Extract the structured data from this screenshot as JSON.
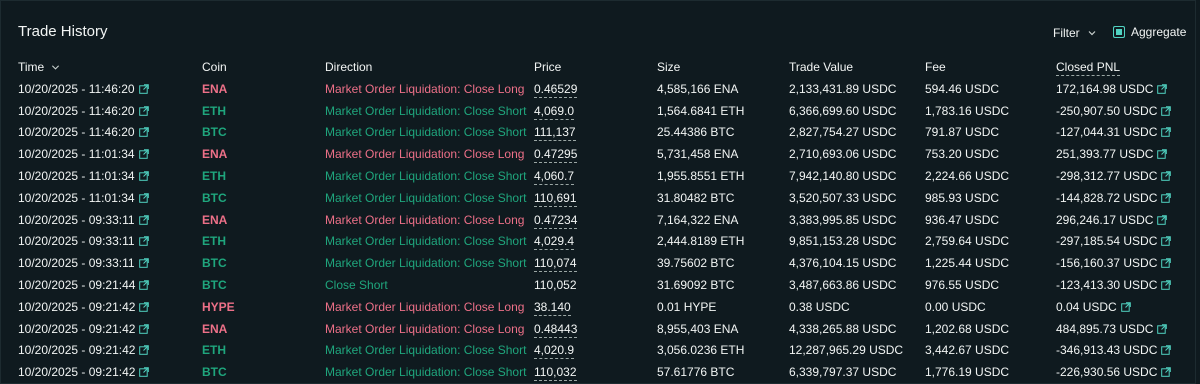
{
  "header": {
    "title": "Trade History",
    "filter_label": "Filter",
    "aggregate_label": "Aggregate",
    "aggregate_checked": true
  },
  "colors": {
    "long": "#ed7088",
    "short": "#1fa67d",
    "accent": "#50d2c1"
  },
  "columns": [
    "Time",
    "Coin",
    "Direction",
    "Price",
    "Size",
    "Trade Value",
    "Fee",
    "Closed PNL"
  ],
  "rows": [
    {
      "time": "10/20/2025 - 11:46:20",
      "coin": "ENA",
      "side": "long",
      "direction": "Market Order Liquidation: Close Long",
      "price": "0.46529",
      "price_dotted": true,
      "size": "4,585,166 ENA",
      "value": "2,133,431.89 USDC",
      "fee": "594.46 USDC",
      "pnl": "172,164.98 USDC"
    },
    {
      "time": "10/20/2025 - 11:46:20",
      "coin": "ETH",
      "side": "short",
      "direction": "Market Order Liquidation: Close Short",
      "price": "4,069.0",
      "price_dotted": true,
      "size": "1,564.6841 ETH",
      "value": "6,366,699.60 USDC",
      "fee": "1,783.16 USDC",
      "pnl": "-250,907.50 USDC"
    },
    {
      "time": "10/20/2025 - 11:46:20",
      "coin": "BTC",
      "side": "short",
      "direction": "Market Order Liquidation: Close Short",
      "price": "111,137",
      "price_dotted": true,
      "size": "25.44386 BTC",
      "value": "2,827,754.27 USDC",
      "fee": "791.87 USDC",
      "pnl": "-127,044.31 USDC"
    },
    {
      "time": "10/20/2025 - 11:01:34",
      "coin": "ENA",
      "side": "long",
      "direction": "Market Order Liquidation: Close Long",
      "price": "0.47295",
      "price_dotted": true,
      "size": "5,731,458 ENA",
      "value": "2,710,693.06 USDC",
      "fee": "753.20 USDC",
      "pnl": "251,393.77 USDC"
    },
    {
      "time": "10/20/2025 - 11:01:34",
      "coin": "ETH",
      "side": "short",
      "direction": "Market Order Liquidation: Close Short",
      "price": "4,060.7",
      "price_dotted": true,
      "size": "1,955.8551 ETH",
      "value": "7,942,140.80 USDC",
      "fee": "2,224.66 USDC",
      "pnl": "-298,312.77 USDC"
    },
    {
      "time": "10/20/2025 - 11:01:34",
      "coin": "BTC",
      "side": "short",
      "direction": "Market Order Liquidation: Close Short",
      "price": "110,691",
      "price_dotted": true,
      "size": "31.80482 BTC",
      "value": "3,520,507.33 USDC",
      "fee": "985.93 USDC",
      "pnl": "-144,828.72 USDC"
    },
    {
      "time": "10/20/2025 - 09:33:11",
      "coin": "ENA",
      "side": "long",
      "direction": "Market Order Liquidation: Close Long",
      "price": "0.47234",
      "price_dotted": true,
      "size": "7,164,322 ENA",
      "value": "3,383,995.85 USDC",
      "fee": "936.47 USDC",
      "pnl": "296,246.17 USDC"
    },
    {
      "time": "10/20/2025 - 09:33:11",
      "coin": "ETH",
      "side": "short",
      "direction": "Market Order Liquidation: Close Short",
      "price": "4,029.4",
      "price_dotted": true,
      "size": "2,444.8189 ETH",
      "value": "9,851,153.28 USDC",
      "fee": "2,759.64 USDC",
      "pnl": "-297,185.54 USDC"
    },
    {
      "time": "10/20/2025 - 09:33:11",
      "coin": "BTC",
      "side": "short",
      "direction": "Market Order Liquidation: Close Short",
      "price": "110,074",
      "price_dotted": true,
      "size": "39.75602 BTC",
      "value": "4,376,104.15 USDC",
      "fee": "1,225.44 USDC",
      "pnl": "-156,160.37 USDC"
    },
    {
      "time": "10/20/2025 - 09:21:44",
      "coin": "BTC",
      "side": "short",
      "direction": "Close Short",
      "price": "110,052",
      "price_dotted": false,
      "size": "31.69092 BTC",
      "value": "3,487,663.86 USDC",
      "fee": "976.55 USDC",
      "pnl": "-123,413.30 USDC"
    },
    {
      "time": "10/20/2025 - 09:21:42",
      "coin": "HYPE",
      "side": "long",
      "direction": "Market Order Liquidation: Close Long",
      "price": "38.140",
      "price_dotted": true,
      "size": "0.01 HYPE",
      "value": "0.38 USDC",
      "fee": "0.00 USDC",
      "pnl": "0.04 USDC"
    },
    {
      "time": "10/20/2025 - 09:21:42",
      "coin": "ENA",
      "side": "long",
      "direction": "Market Order Liquidation: Close Long",
      "price": "0.48443",
      "price_dotted": true,
      "size": "8,955,403 ENA",
      "value": "4,338,265.88 USDC",
      "fee": "1,202.68 USDC",
      "pnl": "484,895.73 USDC"
    },
    {
      "time": "10/20/2025 - 09:21:42",
      "coin": "ETH",
      "side": "short",
      "direction": "Market Order Liquidation: Close Short",
      "price": "4,020.9",
      "price_dotted": true,
      "size": "3,056.0236 ETH",
      "value": "12,287,965.29 USDC",
      "fee": "3,442.67 USDC",
      "pnl": "-346,913.43 USDC"
    },
    {
      "time": "10/20/2025 - 09:21:42",
      "coin": "BTC",
      "side": "short",
      "direction": "Market Order Liquidation: Close Short",
      "price": "110,032",
      "price_dotted": true,
      "size": "57.61776 BTC",
      "value": "6,339,797.37 USDC",
      "fee": "1,776.19 USDC",
      "pnl": "-226,930.56 USDC"
    }
  ]
}
